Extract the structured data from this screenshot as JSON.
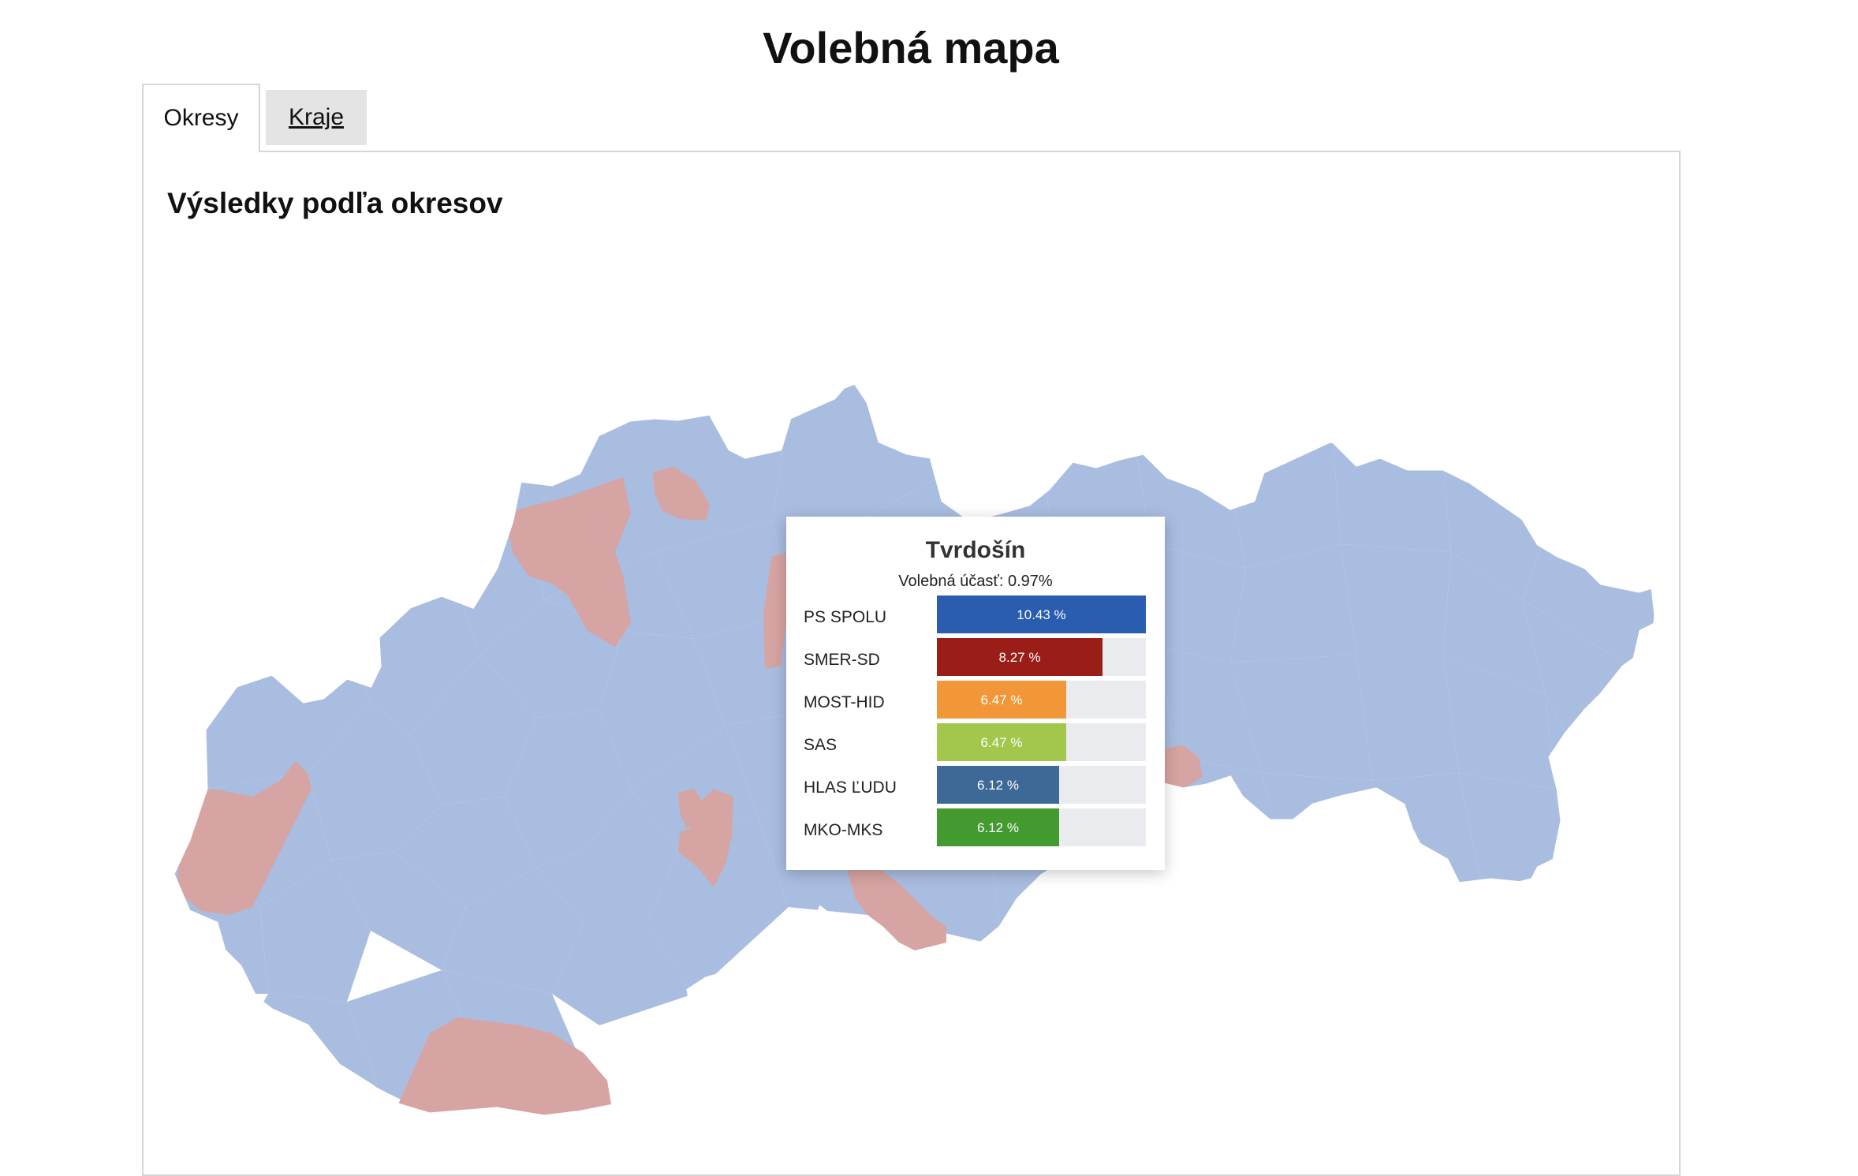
{
  "title": "Volebná mapa",
  "tabs": [
    {
      "label": "Okresy",
      "active": true
    },
    {
      "label": "Kraje",
      "active": false
    }
  ],
  "section_title": "Výsledky podľa okresov",
  "map": {
    "colors": {
      "district_default": "#a9bde0",
      "district_highlight": "#d6a4a2",
      "border": "#ffffff"
    },
    "highlighted_regions": 10
  },
  "tooltip": {
    "district": "Tvrdošín",
    "turnout_label": "Volebná účasť: 0.97%",
    "results": [
      {
        "party": "PS SPOLU",
        "percent": 10.43,
        "label": "10.43 %",
        "color": "#2a5db0"
      },
      {
        "party": "SMER-SD",
        "percent": 8.27,
        "label": "8.27 %",
        "color": "#9b1d17"
      },
      {
        "party": "MOST-HID",
        "percent": 6.47,
        "label": "6.47 %",
        "color": "#f29737"
      },
      {
        "party": "SAS",
        "percent": 6.47,
        "label": "6.47 %",
        "color": "#a3c64c"
      },
      {
        "party": "HLAS ĽUDU",
        "percent": 6.12,
        "label": "6.12 %",
        "color": "#3e6996"
      },
      {
        "party": "MKO-MKS",
        "percent": 6.12,
        "label": "6.12 %",
        "color": "#439a2f"
      }
    ],
    "scale_max_percent": 10.43
  }
}
